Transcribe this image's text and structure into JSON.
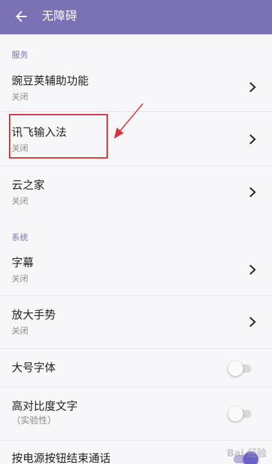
{
  "header": {
    "title": "无障碍",
    "background": "#7b72b5"
  },
  "sections": [
    {
      "title": "服务"
    },
    {
      "title": "系统"
    }
  ],
  "services": [
    {
      "title": "豌豆荚辅助功能",
      "status": "关闭"
    },
    {
      "title": "讯飞输入法",
      "status": "关闭"
    },
    {
      "title": "云之家",
      "status": "关闭"
    }
  ],
  "system": {
    "captions": {
      "title": "字幕",
      "status": "关闭"
    },
    "magnification": {
      "title": "放大手势",
      "status": "关闭"
    },
    "large_text": {
      "title": "大号字体",
      "enabled": false
    },
    "high_contrast": {
      "title": "高对比度文字",
      "subtitle": "（实验性）",
      "enabled": false
    },
    "power_ends_call": {
      "title": "按电源按钮结束通话",
      "enabled": true
    }
  },
  "annotation": {
    "color": "#d6363b"
  },
  "watermark": "Bai 经验"
}
